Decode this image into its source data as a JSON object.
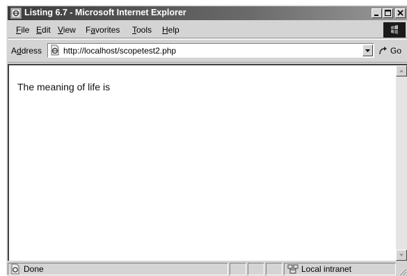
{
  "window": {
    "title": "Listing 6.7 - Microsoft Internet Explorer"
  },
  "menu": {
    "items": [
      {
        "underline": "F",
        "rest": "ile"
      },
      {
        "underline": "E",
        "rest": "dit"
      },
      {
        "underline": "V",
        "rest": "iew"
      },
      {
        "pre": "F",
        "underline": "a",
        "rest": "vorites"
      },
      {
        "underline": "T",
        "rest": "ools"
      },
      {
        "underline": "H",
        "rest": "elp"
      }
    ]
  },
  "address_bar": {
    "label_pre": "A",
    "label_underline": "d",
    "label_rest": "dress",
    "url": "http://localhost/scopetest2.php",
    "go_label": "Go"
  },
  "page": {
    "text": "The meaning of life is"
  },
  "status_bar": {
    "status": "Done",
    "zone": "Local intranet"
  },
  "icons": {
    "title": "ie-page-icon",
    "minimize": "minimize-icon",
    "maximize": "maximize-icon",
    "close": "close-icon",
    "throbber": "windows-logo-icon",
    "address_page": "ie-page-icon",
    "dropdown": "chevron-down-icon",
    "go": "go-arrow-icon",
    "scroll_up": "arrow-up-icon",
    "scroll_down": "arrow-down-icon",
    "status_page": "ie-page-icon",
    "zone": "intranet-computer-icon",
    "grip": "resize-grip-icon"
  }
}
